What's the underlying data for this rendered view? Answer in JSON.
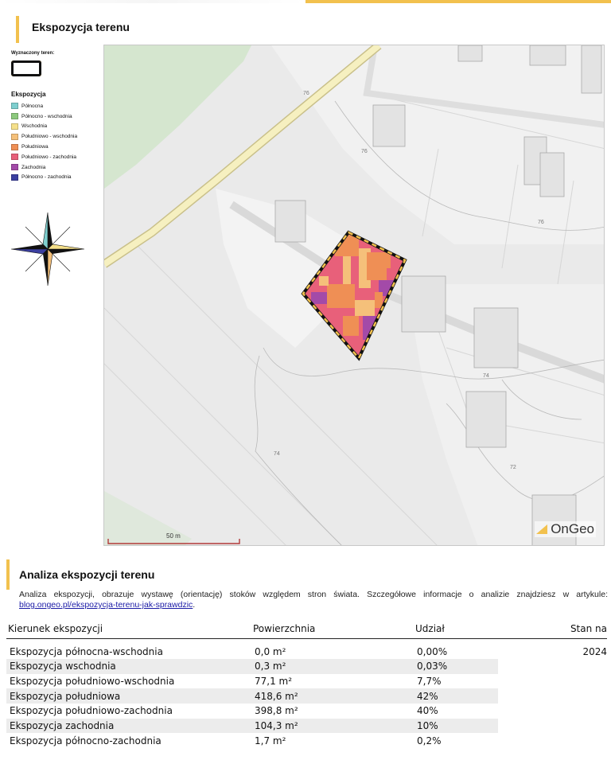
{
  "header": {
    "title": "Ekspozycja terenu"
  },
  "legend": {
    "area_label": "Wyznaczony teren:",
    "title": "Ekspozycja",
    "items": [
      {
        "label": "Północna",
        "color": "#7ecfcf"
      },
      {
        "label": "Północno - wschodnia",
        "color": "#8cc97d"
      },
      {
        "label": "Wschodnia",
        "color": "#f5e08a"
      },
      {
        "label": "Południowo - wschodnia",
        "color": "#f5c07a"
      },
      {
        "label": "Południowa",
        "color": "#ef8f55"
      },
      {
        "label": "Południowo - zachodnia",
        "color": "#e8607a"
      },
      {
        "label": "Zachodnia",
        "color": "#a34aa8"
      },
      {
        "label": "Północno - zachodnia",
        "color": "#3b3fa0"
      }
    ]
  },
  "map": {
    "road_labels": [
      "76",
      "76",
      "76",
      "74",
      "74",
      "72"
    ],
    "scale_label": "50 m",
    "logo_text": "OnGeo"
  },
  "analysis": {
    "title": "Analiza ekspozycji terenu",
    "description": "Analiza ekspozycji, obrazuje wystawę (orientację) stoków względem stron świata. Szczegółowe informacje o analizie znajdziesz w artykule: ",
    "link_text": "blog.ongeo.pl/ekspozycja-terenu-jak-sprawdzic",
    "description_end": ".",
    "columns": [
      "Kierunek ekspozycji",
      "Powierzchnia",
      "Udział",
      "Stan na"
    ],
    "rows": [
      {
        "direction": "Ekspozycja północna-wschodnia",
        "area": "0,0 m²",
        "share": "0,00%",
        "date": "2024"
      },
      {
        "direction": "Ekspozycja wschodnia",
        "area": "0,3 m²",
        "share": "0,03%",
        "date": ""
      },
      {
        "direction": "Ekspozycja południowo-wschodnia",
        "area": "77,1 m²",
        "share": "7,7%",
        "date": ""
      },
      {
        "direction": "Ekspozycja południowa",
        "area": "418,6 m²",
        "share": "42%",
        "date": ""
      },
      {
        "direction": "Ekspozycja południowo-zachodnia",
        "area": "398,8 m²",
        "share": "40%",
        "date": ""
      },
      {
        "direction": "Ekspozycja zachodnia",
        "area": "104,3 m²",
        "share": "10%",
        "date": ""
      },
      {
        "direction": "Ekspozycja północno-zachodnia",
        "area": "1,7 m²",
        "share": "0,2%",
        "date": ""
      }
    ]
  }
}
